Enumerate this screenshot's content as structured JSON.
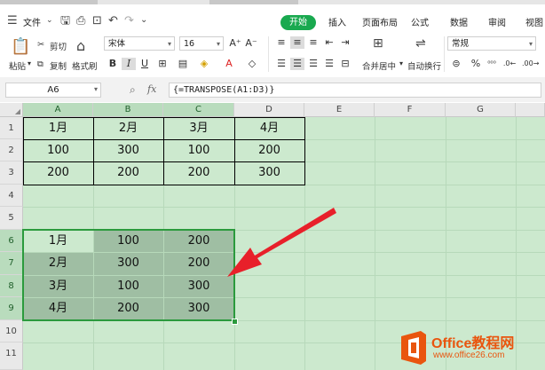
{
  "menu": {
    "file": "文件",
    "tabs": [
      "开始",
      "插入",
      "页面布局",
      "公式",
      "数据",
      "审阅",
      "视图"
    ]
  },
  "ribbon": {
    "paste": "粘贴",
    "cut": "剪切",
    "copy": "复制",
    "format_painter": "格式刷",
    "font_name": "宋体",
    "font_size": "16",
    "merge_center": "合并居中",
    "wrap_text": "自动换行",
    "number_format": "常规"
  },
  "formula_bar": {
    "cell_ref": "A6",
    "fx": "fx",
    "formula": "{=TRANSPOSE(A1:D3)}"
  },
  "columns": [
    "A",
    "B",
    "C",
    "D",
    "E",
    "F",
    "G"
  ],
  "rows": [
    "1",
    "2",
    "3",
    "4",
    "5",
    "6",
    "7",
    "8",
    "9",
    "10",
    "11"
  ],
  "source_table": [
    [
      "1月",
      "2月",
      "3月",
      "4月"
    ],
    [
      "100",
      "300",
      "100",
      "200"
    ],
    [
      "200",
      "200",
      "200",
      "300"
    ]
  ],
  "result_table": [
    [
      "1月",
      "100",
      "200"
    ],
    [
      "2月",
      "300",
      "200"
    ],
    [
      "3月",
      "100",
      "300"
    ],
    [
      "4月",
      "200",
      "300"
    ]
  ],
  "watermark": {
    "title": "Office教程网",
    "url": "www.office26.com"
  },
  "colors": {
    "accent": "#19a94f",
    "sheet_bg": "#cce9ce",
    "selection": "#9fbea3",
    "arrow": "#e8202a",
    "watermark": "#e9550e"
  }
}
